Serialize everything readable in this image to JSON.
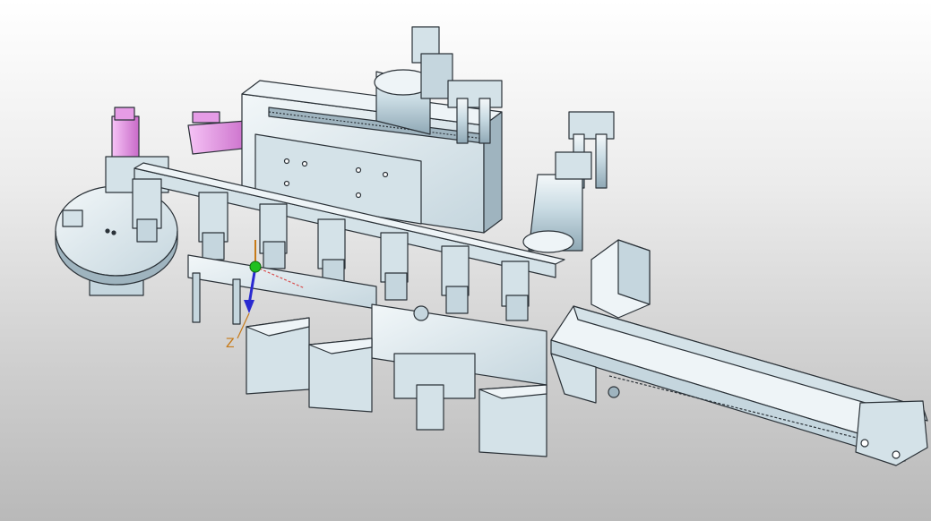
{
  "viewport": {
    "background_top": "#ffffff",
    "background_bottom": "#b9b9b9"
  },
  "triad": {
    "z_label": "Z",
    "z_color": "#c77a18",
    "y_color": "#2a2ad0",
    "x_color": "#d84c4c",
    "origin_color": "#20c020"
  },
  "colors": {
    "metal": "#d4e2e8",
    "metal_dark": "#9fb4bf",
    "metal_light": "#eef4f7",
    "edge": "#2b3238",
    "cylinder": "#bcd3de",
    "highlight_part": "#e69ce6"
  }
}
